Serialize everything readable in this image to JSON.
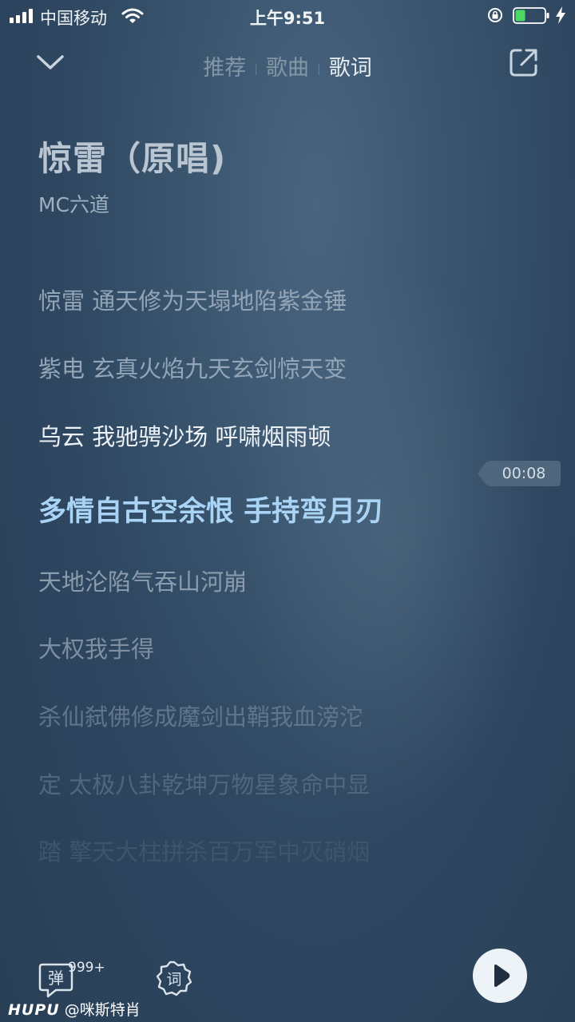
{
  "status_bar": {
    "carrier": "中国移动",
    "time": "上午9:51"
  },
  "nav": {
    "tabs": [
      {
        "label": "推荐",
        "active": false
      },
      {
        "label": "歌曲",
        "active": false
      },
      {
        "label": "歌词",
        "active": true
      }
    ]
  },
  "song": {
    "title": "惊雷（原唱)",
    "artist": "MC六道"
  },
  "lyrics": [
    {
      "text": "惊雷 通天修为天塌地陷紫金锤",
      "state": "past"
    },
    {
      "text": "紫电 玄真火焰九天玄剑惊天变",
      "state": "past"
    },
    {
      "text": "乌云 我驰骋沙场 呼啸烟雨顿",
      "state": "recent"
    },
    {
      "text": "多情自古空余恨 手持弯月刃",
      "state": "current"
    },
    {
      "text": "天地沦陷气吞山河崩",
      "state": "upcoming"
    },
    {
      "text": "大权我手得",
      "state": "upcoming"
    },
    {
      "text": "杀仙弑佛修成魔剑出鞘我血滂沱",
      "state": "fade1"
    },
    {
      "text": "定 太极八卦乾坤万物星象命中显",
      "state": "fade2"
    },
    {
      "text": "踏 擎天大柱拼杀百万军中灭硝烟",
      "state": "fade3"
    }
  ],
  "timestamp": "00:08",
  "bottom": {
    "danmu_label": "弹",
    "danmu_count": "999+",
    "lyric_label": "词"
  },
  "watermark": {
    "brand": "HUPU",
    "user": "@咪斯特肖"
  },
  "colors": {
    "current_line": "#a9d4f5",
    "recent_line": "#eef3f8"
  }
}
